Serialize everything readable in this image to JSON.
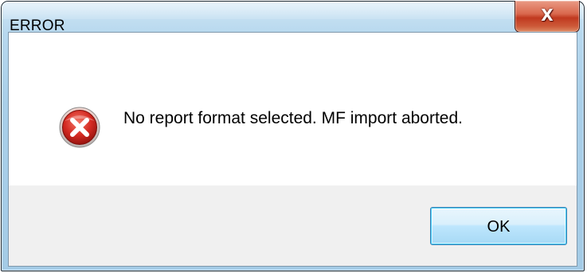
{
  "window": {
    "title": "ERROR"
  },
  "title_bar": {
    "close_glyph": "X",
    "close_icon": "close-icon"
  },
  "message": {
    "icon": "error-icon",
    "text": "No report format selected.  MF import aborted."
  },
  "buttons": {
    "ok_label": "OK"
  },
  "colors": {
    "close_button": "#c0391f",
    "error_icon": "#c81e1e",
    "ok_button_border": "#3c7fb1",
    "window_frame": "#a9cfe9"
  }
}
